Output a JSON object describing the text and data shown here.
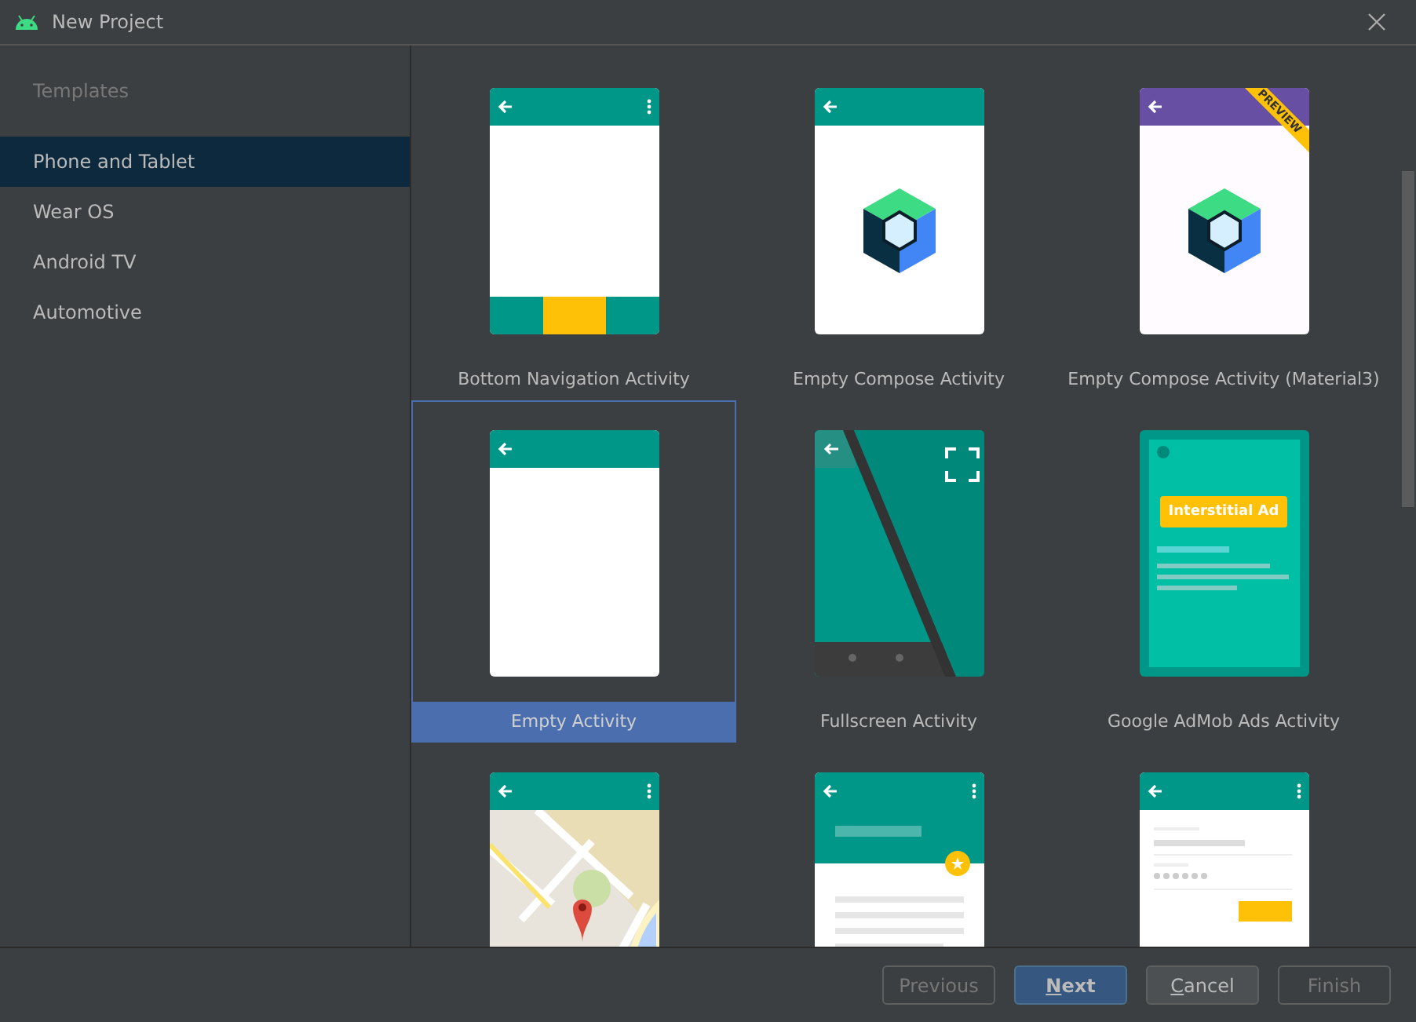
{
  "window": {
    "title": "New Project"
  },
  "sidebar": {
    "heading": "Templates",
    "items": [
      {
        "label": "Phone and Tablet",
        "selected": true
      },
      {
        "label": "Wear OS",
        "selected": false
      },
      {
        "label": "Android TV",
        "selected": false
      },
      {
        "label": "Automotive",
        "selected": false
      }
    ]
  },
  "templates": [
    {
      "kind": "bottom-nav",
      "label": "Bottom Navigation Activity",
      "selected": false
    },
    {
      "kind": "compose",
      "label": "Empty Compose Activity",
      "selected": false
    },
    {
      "kind": "compose-material3",
      "label": "Empty Compose Activity (Material3)",
      "badge": "PREVIEW",
      "selected": false
    },
    {
      "kind": "empty",
      "label": "Empty Activity",
      "selected": true
    },
    {
      "kind": "fullscreen",
      "label": "Fullscreen Activity",
      "selected": false
    },
    {
      "kind": "admob",
      "label": "Google AdMob Ads Activity",
      "ad_label": "Interstitial Ad",
      "selected": false
    },
    {
      "kind": "maps",
      "selected": false
    },
    {
      "kind": "scrolling",
      "selected": false
    },
    {
      "kind": "login",
      "selected": false
    }
  ],
  "buttons": [
    {
      "label": "Previous",
      "kind": "default",
      "disabled": true,
      "mnemonic": false
    },
    {
      "label": "Next",
      "kind": "primary",
      "disabled": false,
      "mnemonic": true
    },
    {
      "label": "Cancel",
      "kind": "default",
      "disabled": false,
      "mnemonic": true
    },
    {
      "label": "Finish",
      "kind": "default",
      "disabled": true,
      "mnemonic": false
    }
  ]
}
